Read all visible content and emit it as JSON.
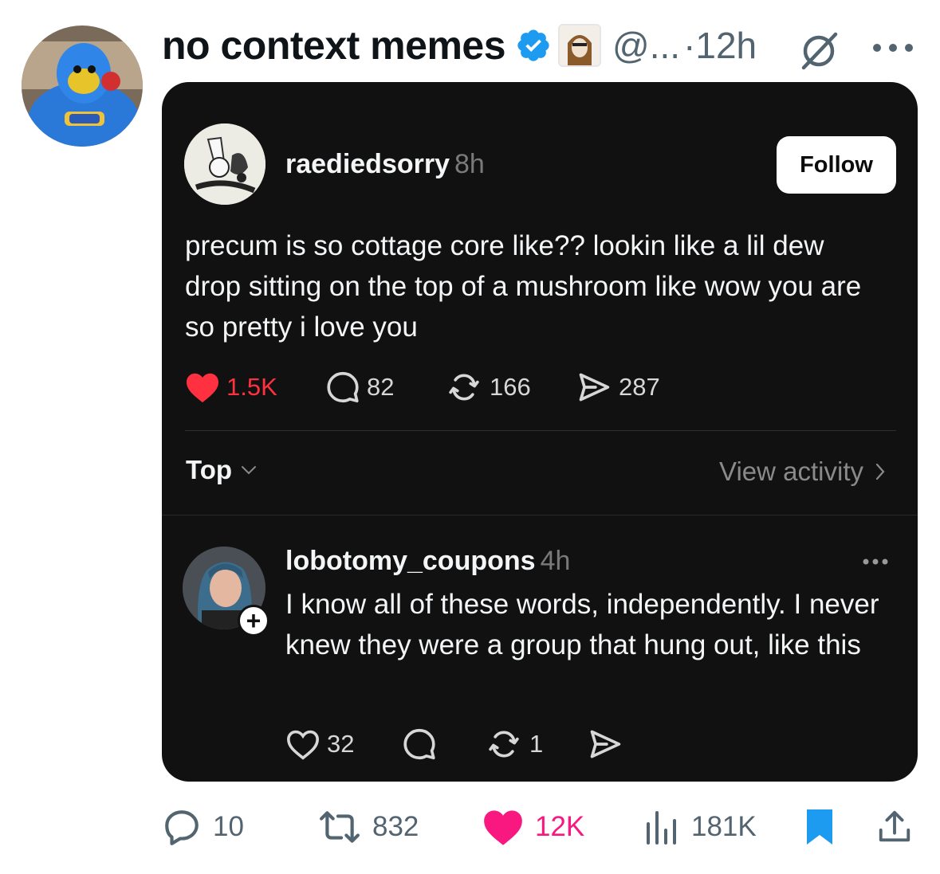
{
  "tweet": {
    "author_name": "no context memes",
    "handle": "@...",
    "time": "·12h",
    "stats": {
      "replies": "10",
      "retweets": "832",
      "likes": "12K",
      "views": "181K"
    }
  },
  "embedded_post": {
    "username": "raediedsorry",
    "time": "8h",
    "follow_label": "Follow",
    "text": "precum is so cottage core like?? lookin like a lil dew drop sitting on the top of a mushroom like wow you are so pretty i love you",
    "likes": "1.5K",
    "comments": "82",
    "reposts": "166",
    "shares": "287",
    "sort_label": "Top",
    "view_activity_label": "View activity",
    "comment": {
      "username": "lobotomy_coupons",
      "time": "4h",
      "text": "I know all of these words, independently. I never knew they were a group that hung out, like this",
      "likes": "32",
      "reposts": "1",
      "plus_symbol": "+"
    }
  },
  "colors": {
    "card_bg": "#111111",
    "like_red": "#ff3040",
    "twitter_pink": "#f91880",
    "twitter_blue": "#1d9bf0",
    "muted_gray": "#536471"
  }
}
